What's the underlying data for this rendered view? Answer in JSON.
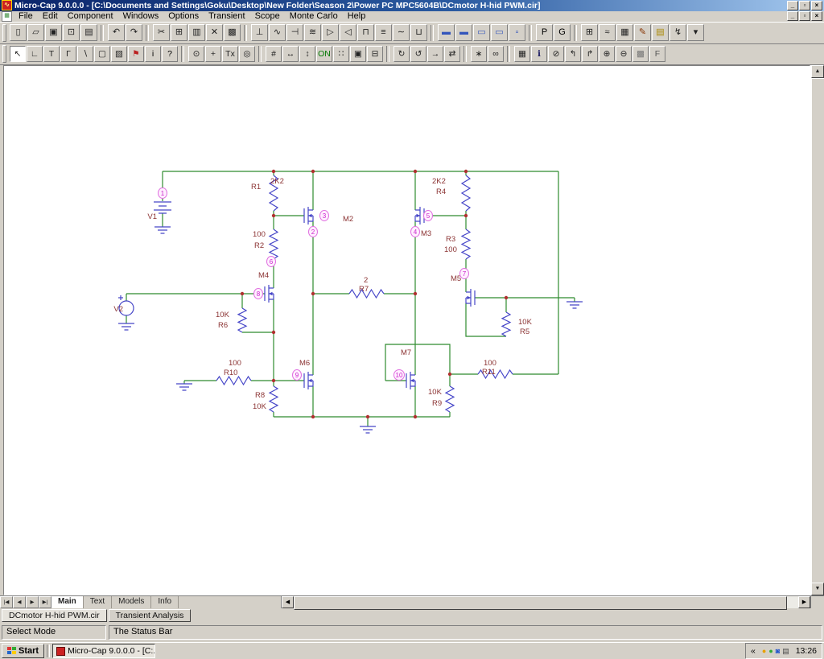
{
  "window": {
    "title": "Micro-Cap 9.0.0.0 - [C:\\Documents and Settings\\Goku\\Desktop\\New Folder\\Season 2\\Power PC MPC5604B\\DCmotor H-hid PWM.cir]",
    "app_icon_glyph": "∿",
    "controls": {
      "minimize": "_",
      "restore": "▫",
      "close": "×"
    }
  },
  "menu": {
    "items": [
      {
        "name": "menu-file",
        "label": "File"
      },
      {
        "name": "menu-edit",
        "label": "Edit"
      },
      {
        "name": "menu-component",
        "label": "Component"
      },
      {
        "name": "menu-windows",
        "label": "Windows"
      },
      {
        "name": "menu-options",
        "label": "Options"
      },
      {
        "name": "menu-transient",
        "label": "Transient"
      },
      {
        "name": "menu-scope",
        "label": "Scope"
      },
      {
        "name": "menu-monte-carlo",
        "label": "Monte Carlo"
      },
      {
        "name": "menu-help",
        "label": "Help"
      }
    ]
  },
  "toolbar_main": {
    "items": [
      {
        "name": "new-file-button",
        "glyph": "▯"
      },
      {
        "name": "open-file-button",
        "glyph": "▱"
      },
      {
        "name": "save-button",
        "glyph": "▣"
      },
      {
        "name": "print-preview-button",
        "glyph": "⊡"
      },
      {
        "name": "print-button",
        "glyph": "▤"
      },
      {
        "sep": true
      },
      {
        "name": "undo-button",
        "glyph": "↶"
      },
      {
        "name": "redo-button",
        "glyph": "↷"
      },
      {
        "sep": true
      },
      {
        "name": "cut-button",
        "glyph": "✂"
      },
      {
        "name": "copy-button",
        "glyph": "⊞"
      },
      {
        "name": "paste-button",
        "glyph": "▥"
      },
      {
        "name": "delete-button",
        "glyph": "✕"
      },
      {
        "name": "select-all-button",
        "glyph": "▩"
      },
      {
        "sep": true
      },
      {
        "name": "component-ground-button",
        "glyph": "⊥"
      },
      {
        "name": "component-resistor-button",
        "glyph": "∿"
      },
      {
        "name": "component-capacitor-button",
        "glyph": "⊣"
      },
      {
        "name": "component-inductor-button",
        "glyph": "≋"
      },
      {
        "name": "component-diode-button",
        "glyph": "▷"
      },
      {
        "name": "component-transistor-button",
        "glyph": "◁"
      },
      {
        "name": "component-mosfet-button",
        "glyph": "⊓"
      },
      {
        "name": "component-battery-button",
        "glyph": "≡"
      },
      {
        "name": "component-sine-source-button",
        "glyph": "∼"
      },
      {
        "name": "component-pulse-source-button",
        "glyph": "⊔"
      },
      {
        "sep": true
      },
      {
        "name": "window-transient-button",
        "glyph": "▬",
        "color": "#3355bb"
      },
      {
        "name": "window-ac-button",
        "glyph": "▬",
        "color": "#3355bb"
      },
      {
        "name": "window-dc-button",
        "glyph": "▭",
        "color": "#3355bb"
      },
      {
        "name": "window-schematic-button",
        "glyph": "▭",
        "color": "#3355bb"
      },
      {
        "name": "window-text-button",
        "glyph": "▫",
        "color": "#3355bb"
      },
      {
        "sep": true
      },
      {
        "name": "probe-letter-button",
        "glyph": "P",
        "color": "#000"
      },
      {
        "name": "go-letter-button",
        "glyph": "G",
        "color": "#000"
      },
      {
        "sep": true
      },
      {
        "name": "grid-button",
        "glyph": "⊞"
      },
      {
        "name": "waveform-button",
        "glyph": "≈"
      },
      {
        "name": "calculator-button",
        "glyph": "▦"
      },
      {
        "name": "pencil-tool-button",
        "glyph": "✎",
        "color": "#883300"
      },
      {
        "name": "notes-button",
        "glyph": "▤",
        "color": "#aa8800"
      },
      {
        "name": "probe-tool-button",
        "glyph": "↯"
      },
      {
        "name": "more-tools-button",
        "glyph": "▾"
      }
    ]
  },
  "toolbar_mode": {
    "items": [
      {
        "name": "select-mode-button",
        "glyph": "↖",
        "active": true
      },
      {
        "name": "wire-mode-button",
        "glyph": "∟"
      },
      {
        "name": "text-mode-button",
        "glyph": "T"
      },
      {
        "name": "wire-diagonal-mode-button",
        "glyph": "Γ"
      },
      {
        "name": "line-mode-button",
        "glyph": "∖"
      },
      {
        "name": "rectangle-mode-button",
        "glyph": "▢"
      },
      {
        "name": "pattern-mode-button",
        "glyph": "▧"
      },
      {
        "name": "flag-mode-button",
        "glyph": "⚑",
        "color": "#bb2222"
      },
      {
        "name": "info-mode-button",
        "glyph": "i",
        "color": "#000"
      },
      {
        "name": "help-mode-button",
        "glyph": "?",
        "color": "#000"
      },
      {
        "sep": true
      },
      {
        "name": "node-snap-button",
        "glyph": "⊙"
      },
      {
        "name": "pin-connect-button",
        "glyph": "+"
      },
      {
        "name": "text-grid-button",
        "glyph": "Tx"
      },
      {
        "name": "crosshair-button",
        "glyph": "◎"
      },
      {
        "sep": true
      },
      {
        "name": "node-numbers-button",
        "glyph": "#"
      },
      {
        "name": "measure-h-button",
        "glyph": "↔"
      },
      {
        "name": "measure-v-button",
        "glyph": "↕"
      },
      {
        "name": "show-on-button",
        "glyph": "ON",
        "color": "#007700"
      },
      {
        "name": "dot-grid-button",
        "glyph": "∷"
      },
      {
        "name": "border-button",
        "glyph": "▣"
      },
      {
        "name": "title-block-button",
        "glyph": "⊟"
      },
      {
        "sep": true
      },
      {
        "name": "redraw-button",
        "glyph": "↻"
      },
      {
        "name": "back-button",
        "glyph": "↺"
      },
      {
        "name": "step-button",
        "glyph": "→"
      },
      {
        "name": "repeat-button",
        "glyph": "⇄"
      },
      {
        "sep": true
      },
      {
        "name": "find-button",
        "glyph": "∗"
      },
      {
        "name": "find-component-button",
        "glyph": "∞"
      },
      {
        "sep": true
      },
      {
        "name": "window-tile-button",
        "glyph": "▦"
      },
      {
        "name": "info-circle-button",
        "glyph": "ℹ",
        "color": "#222266"
      },
      {
        "name": "no-connect-button",
        "glyph": "⊘"
      },
      {
        "name": "page-prev-button",
        "glyph": "↰"
      },
      {
        "name": "page-next-button",
        "glyph": "↱"
      },
      {
        "name": "zoom-in-button",
        "glyph": "⊕"
      },
      {
        "name": "zoom-out-button",
        "glyph": "⊖"
      },
      {
        "name": "image-button",
        "glyph": "▩",
        "color": "#777777"
      },
      {
        "name": "help-f-button",
        "glyph": "F",
        "color": "#555555"
      }
    ]
  },
  "schematic": {
    "components": {
      "V1": {
        "name": "V1"
      },
      "V2": {
        "name": "V2"
      },
      "R1": {
        "name": "R1",
        "value": "2K2"
      },
      "R2": {
        "name": "R2",
        "value": "100"
      },
      "R3": {
        "name": "R3",
        "value": "100"
      },
      "R4": {
        "name": "R4",
        "value": "2K2"
      },
      "R5": {
        "name": "R5",
        "value": "10K"
      },
      "R6": {
        "name": "R6",
        "value": "10K"
      },
      "R7": {
        "name": "R7",
        "value": "2"
      },
      "R8": {
        "name": "R8",
        "value": "10K"
      },
      "R9": {
        "name": "R9",
        "value": "10K"
      },
      "R10": {
        "name": "R10",
        "value": "100"
      },
      "R11": {
        "name": "R11",
        "value": "100"
      },
      "M2": {
        "name": "M2"
      },
      "M3": {
        "name": "M3"
      },
      "M4": {
        "name": "M4"
      },
      "M5": {
        "name": "M5"
      },
      "M6": {
        "name": "M6"
      },
      "M7": {
        "name": "M7"
      }
    },
    "nodes": [
      "1",
      "2",
      "3",
      "4",
      "5",
      "6",
      "7",
      "8",
      "9",
      "10"
    ],
    "colors": {
      "wire": "#2E8B2E",
      "component": "#4646C8",
      "label": "#8B3333",
      "node_text": "#CC22CC",
      "node_bubble": "#E070E0",
      "junction": "#B03030"
    }
  },
  "sheet_nav": {
    "items": [
      {
        "name": "first-sheet-button",
        "glyph": "|◀"
      },
      {
        "name": "prev-sheet-button",
        "glyph": "◀"
      },
      {
        "name": "next-sheet-button",
        "glyph": "▶"
      },
      {
        "name": "last-sheet-button",
        "glyph": "▶|"
      }
    ]
  },
  "sheet_tabs": {
    "items": [
      {
        "name": "sheet-tab-main",
        "label": "Main",
        "active": true
      },
      {
        "name": "sheet-tab-text",
        "label": "Text"
      },
      {
        "name": "sheet-tab-models",
        "label": "Models"
      },
      {
        "name": "sheet-tab-info",
        "label": "Info"
      }
    ]
  },
  "file_tabs": {
    "items": [
      {
        "name": "file-tab-dcmotor",
        "label": "DCmotor H-hid PWM.cir",
        "active": true
      },
      {
        "name": "file-tab-transient",
        "label": "Transient Analysis"
      }
    ]
  },
  "status_bar": {
    "mode": "Select Mode",
    "message": "The Status Bar"
  },
  "taskbar": {
    "start_label": "Start",
    "task_label": "Micro-Cap 9.0.0.0 - [C:...",
    "chevron": "«",
    "clock": "13:26",
    "tray_icons": [
      {
        "name": "tray-icon-update",
        "glyph": "●",
        "color": "#E8A000"
      },
      {
        "name": "tray-icon-network",
        "glyph": "●",
        "color": "#33AA33"
      },
      {
        "name": "tray-icon-volume",
        "glyph": "◙",
        "color": "#2255CC"
      },
      {
        "name": "tray-icon-keyboard",
        "glyph": "▤",
        "color": "#444444"
      }
    ]
  }
}
